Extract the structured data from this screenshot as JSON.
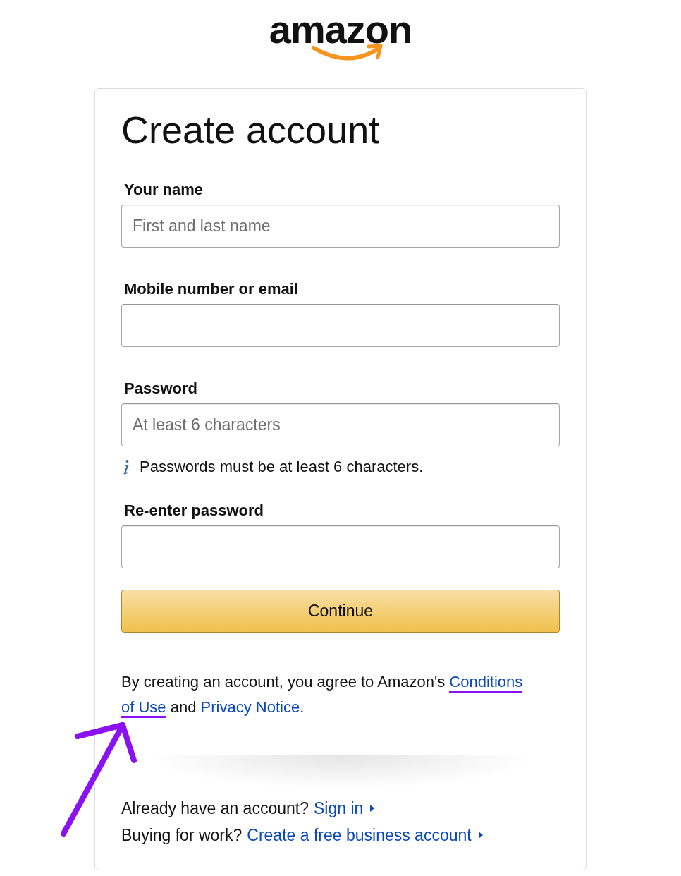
{
  "logo": {
    "text": "amazon"
  },
  "title": "Create account",
  "fields": [
    {
      "label": "Your name",
      "placeholder": "First and last name"
    },
    {
      "label": "Mobile number or email"
    },
    {
      "label": "Password",
      "placeholder": "At least 6 characters",
      "hint": "Passwords must be at least 6 characters."
    },
    {
      "label": "Re-enter password"
    }
  ],
  "continue_button": "Continue",
  "legal": {
    "before": "By creating an account, you agree to Amazon's",
    "links": [
      {
        "text": "Conditions",
        "annotated": true
      },
      {
        "text": "of Use",
        "annotated": true
      },
      {
        "text": "Privacy Notice",
        "annotated": false
      }
    ],
    "between": "and",
    "after": "."
  },
  "footer": [
    {
      "question": "Already have an account?",
      "link": "Sign in"
    },
    {
      "question": "Buying for work?",
      "link": "Create a free business account"
    }
  ],
  "annotation": {
    "kind": "arrow",
    "color": "#8a12f2"
  }
}
